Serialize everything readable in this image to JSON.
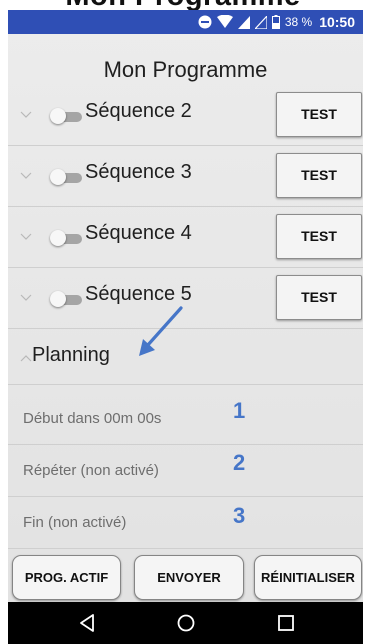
{
  "page": {
    "cut_off_heading": "Mon Programme"
  },
  "status_bar": {
    "battery_percent": "38 %",
    "time": "10:50",
    "colors": {
      "background": "#2f4fb5",
      "text": "#ffffff"
    },
    "icons": [
      "do-not-disturb-icon",
      "wifi-icon",
      "signal-icon",
      "signal-icon",
      "battery-icon"
    ]
  },
  "screen": {
    "title": "Mon Programme"
  },
  "sequences": [
    {
      "label": "Séquence 2",
      "toggle_on": false,
      "test_label": "TEST"
    },
    {
      "label": "Séquence 3",
      "toggle_on": false,
      "test_label": "TEST"
    },
    {
      "label": "Séquence 4",
      "toggle_on": false,
      "test_label": "TEST"
    },
    {
      "label": "Séquence 5",
      "toggle_on": false,
      "test_label": "TEST"
    }
  ],
  "planning": {
    "label": "Planning",
    "expanded": true,
    "items": [
      {
        "label": "Début dans 00m 00s",
        "number": "1"
      },
      {
        "label": "Répéter (non activé)",
        "number": "2"
      },
      {
        "label": "Fin (non activé)",
        "number": "3"
      }
    ]
  },
  "actions": {
    "prog_actif": "PROG. ACTIF",
    "envoyer": "ENVOYER",
    "reinitialiser": "RÉINITIALISER"
  },
  "navigation": {
    "icons": [
      "back-icon",
      "home-icon",
      "recents-icon"
    ]
  },
  "annotation_color": "#4676c8"
}
